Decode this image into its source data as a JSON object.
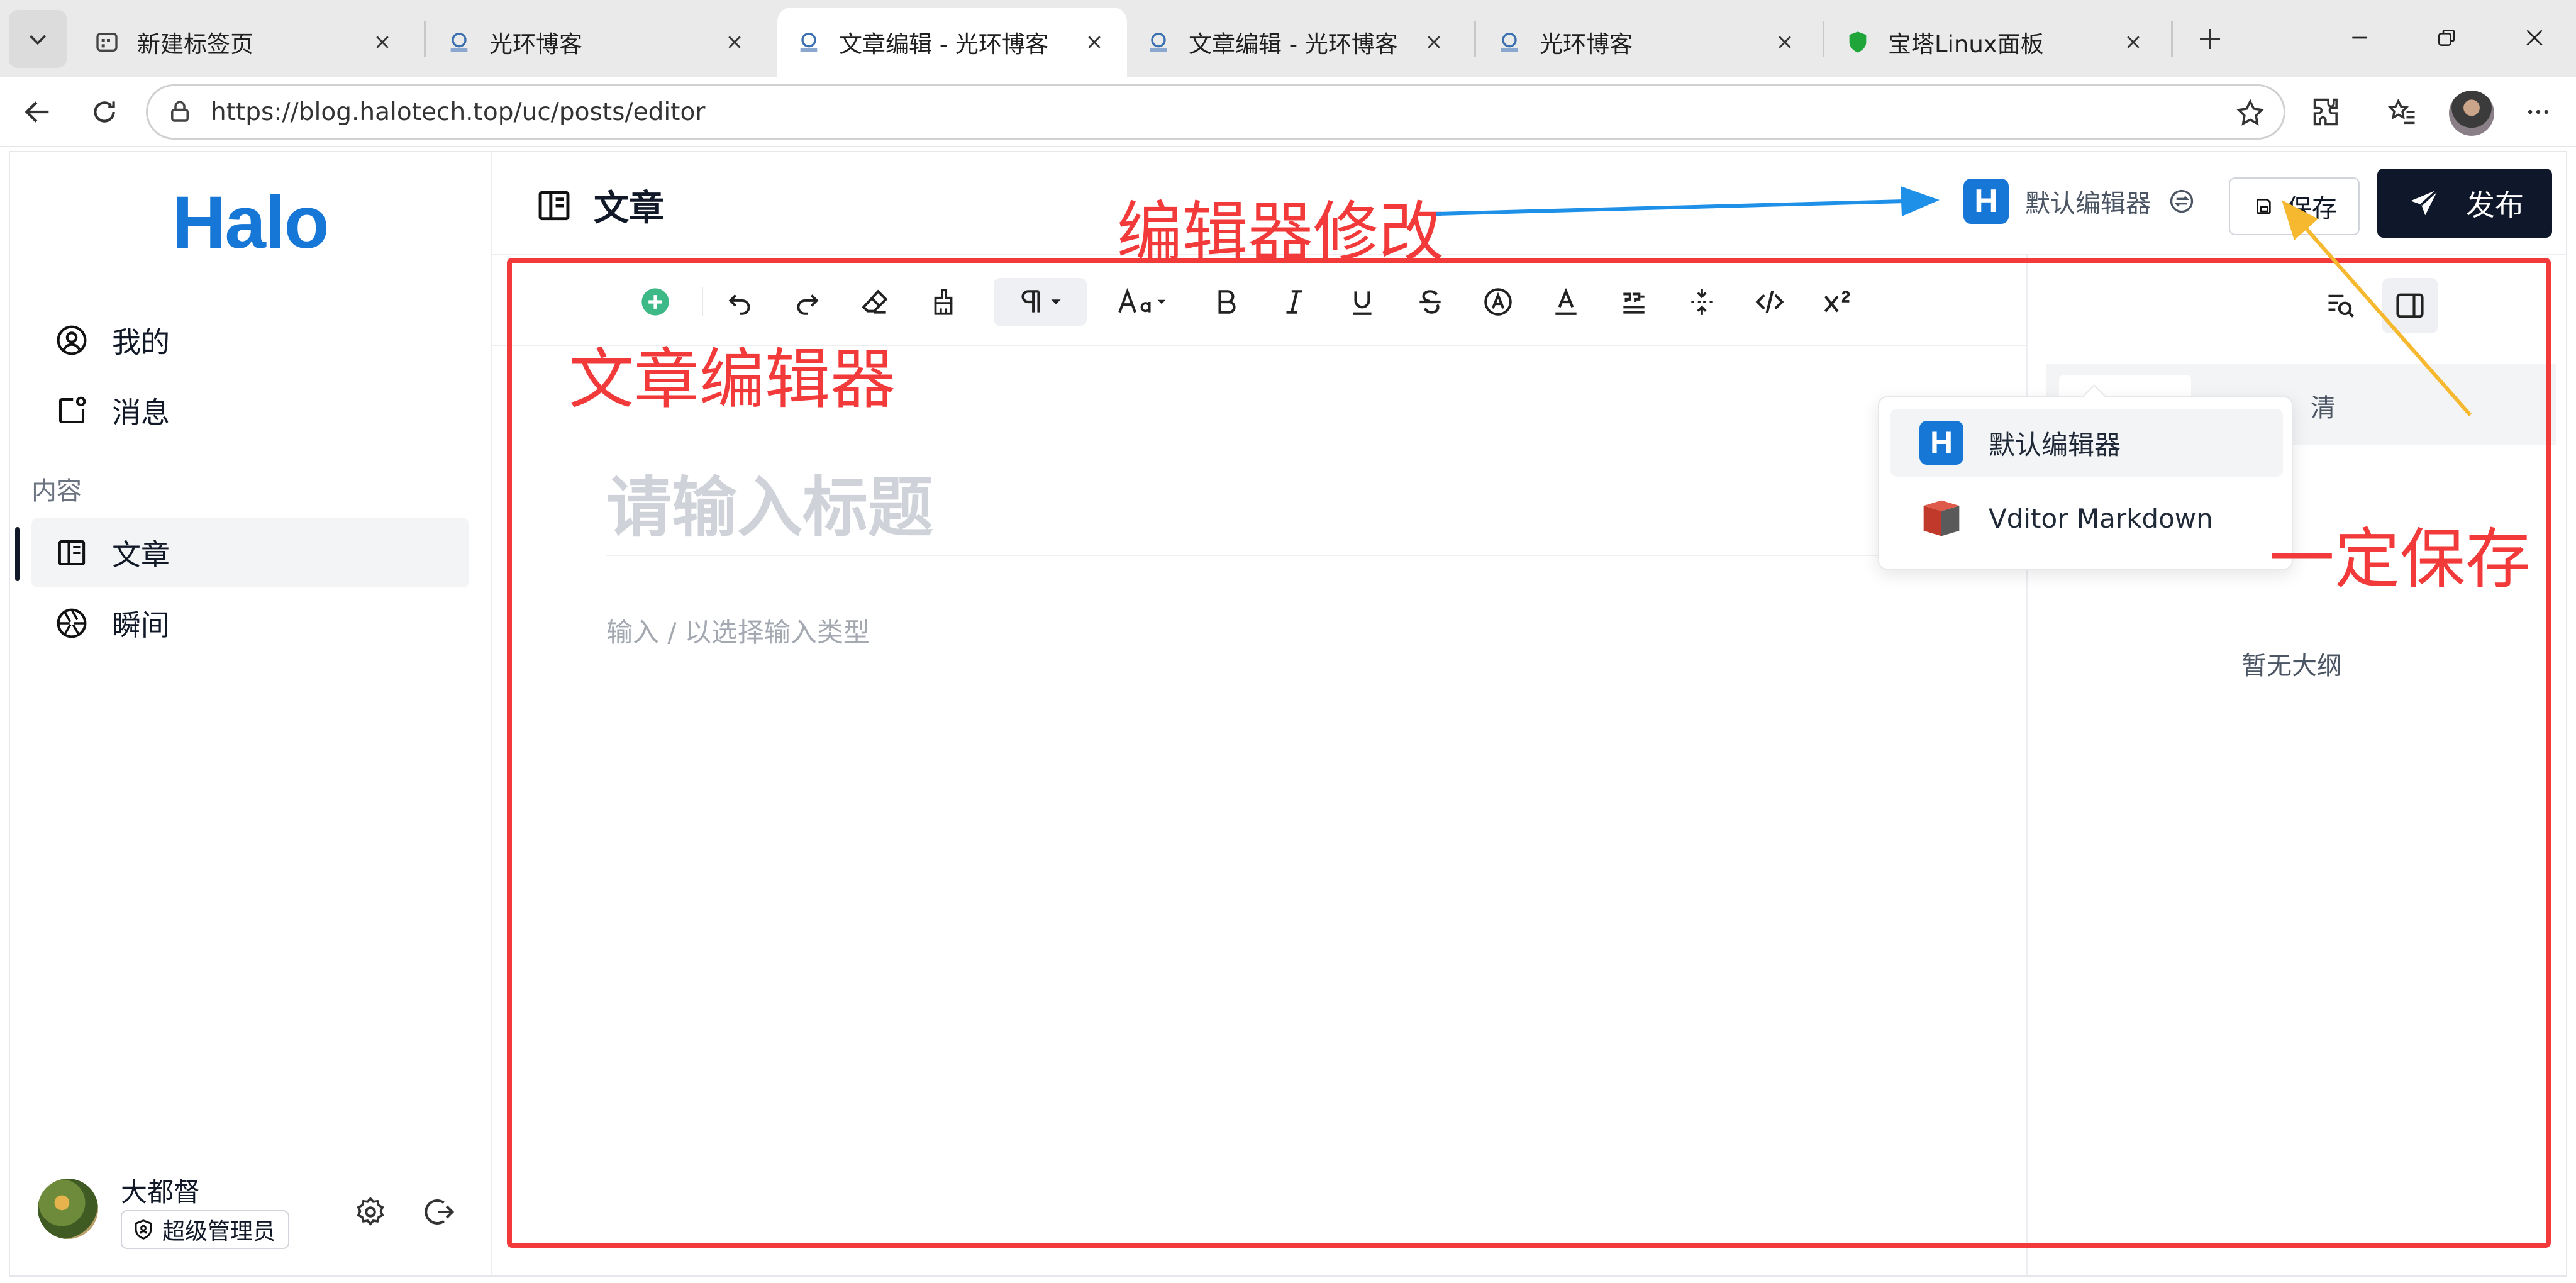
{
  "browser": {
    "tabs": [
      {
        "title": "新建标签页",
        "icon": "new-tab-page-icon",
        "active": false
      },
      {
        "title": "光环博客",
        "icon": "halo-site-icon",
        "active": false
      },
      {
        "title": "文章编辑 - 光环博客",
        "icon": "halo-site-icon",
        "active": true
      },
      {
        "title": "文章编辑 - 光环博客",
        "icon": "halo-site-icon",
        "active": false
      },
      {
        "title": "光环博客",
        "icon": "halo-site-icon",
        "active": false
      },
      {
        "title": "宝塔Linux面板",
        "icon": "bt-shield-icon",
        "active": false
      }
    ],
    "url": "https://blog.halotech.top/uc/posts/editor"
  },
  "app": {
    "logo": "Halo",
    "sidebar": {
      "items": [
        {
          "label": "我的",
          "icon": "user-circle-icon"
        },
        {
          "label": "消息",
          "icon": "message-icon"
        }
      ],
      "group_label": "内容",
      "content_items": [
        {
          "label": "文章",
          "icon": "article-icon",
          "active": true
        },
        {
          "label": "瞬间",
          "icon": "aperture-icon",
          "active": false
        }
      ]
    },
    "user": {
      "name": "大都督",
      "role": "超级管理员"
    },
    "header": {
      "title": "文章",
      "editor_badge": "H",
      "editor_name": "默认编辑器",
      "save_label": "保存",
      "publish_label": "发布"
    },
    "editor": {
      "title_placeholder": "请输入标题",
      "body_placeholder": "输入 / 以选择输入类型"
    },
    "outline": {
      "tab_label": "清",
      "empty_text": "暂无大纲"
    },
    "editor_dropdown": {
      "items": [
        {
          "label": "默认编辑器",
          "icon": "halo-h-icon",
          "selected": true
        },
        {
          "label": "Vditor Markdown",
          "icon": "vditor-book-icon",
          "selected": false
        }
      ]
    }
  },
  "annotations": {
    "editor_change": "编辑器修改",
    "article_editor": "文章编辑器",
    "must_save": "一定保存",
    "colors": {
      "red": "#f23a3a",
      "blue": "#1e90e8",
      "yellow": "#f5b82e"
    }
  },
  "colors": {
    "brand": "#1677d6",
    "publish_bg": "#0f172a",
    "add_green": "#3db887"
  }
}
